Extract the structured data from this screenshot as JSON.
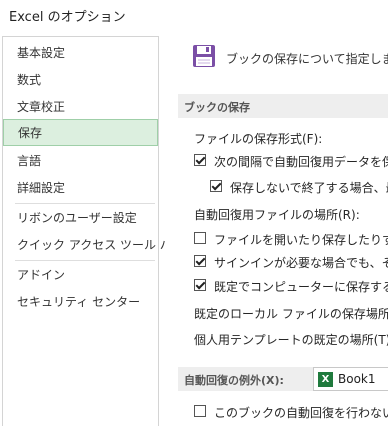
{
  "window": {
    "title": "Excel のオプション"
  },
  "sidebar": {
    "items": [
      {
        "label": "基本設定"
      },
      {
        "label": "数式"
      },
      {
        "label": "文章校正"
      },
      {
        "label": "保存"
      },
      {
        "label": "言語"
      },
      {
        "label": "詳細設定"
      },
      {
        "label": "リボンのユーザー設定"
      },
      {
        "label": "クイック アクセス ツール バー"
      },
      {
        "label": "アドイン"
      },
      {
        "label": "セキュリティ センター"
      }
    ],
    "active": "保存"
  },
  "main": {
    "header_text": "ブックの保存について指定しま",
    "header_icon": "save-disk-icon",
    "section_save": "ブックの保存",
    "save_format_label": "ファイルの保存形式(F):",
    "autorecover_interval_label": "次の間隔で自動回復用データを保",
    "autorecover_interval_checked": true,
    "keep_last_label": "保存しないで終了する場合、最",
    "keep_last_checked": true,
    "autorecover_location_label": "自動回復用ファイルの場所(R):",
    "no_backstage_label": "ファイルを開いたり保存したりするとき",
    "no_backstage_checked": false,
    "show_additional_label": "サインインが必要な場合でも、その他",
    "show_additional_checked": true,
    "save_to_computer_label": "既定でコンピューターに保存する(C)",
    "save_to_computer_checked": true,
    "default_local_location_label": "既定のローカル ファイルの保存場所(I):",
    "default_template_location_label": "個人用テンプレートの既定の場所(T):",
    "section_exceptions": "自動回復の例外(X):",
    "exceptions_workbook": "Book1",
    "exceptions_workbook_icon": "excel-icon",
    "disable_autorecover_label": "このブックの自動回復を行わない(D)",
    "disable_autorecover_checked": false
  },
  "colors": {
    "active_nav_bg": "#dcefdf",
    "active_nav_border": "#9fcfa8",
    "save_icon": "#7b4fa6",
    "excel_green": "#1f7a3d"
  }
}
